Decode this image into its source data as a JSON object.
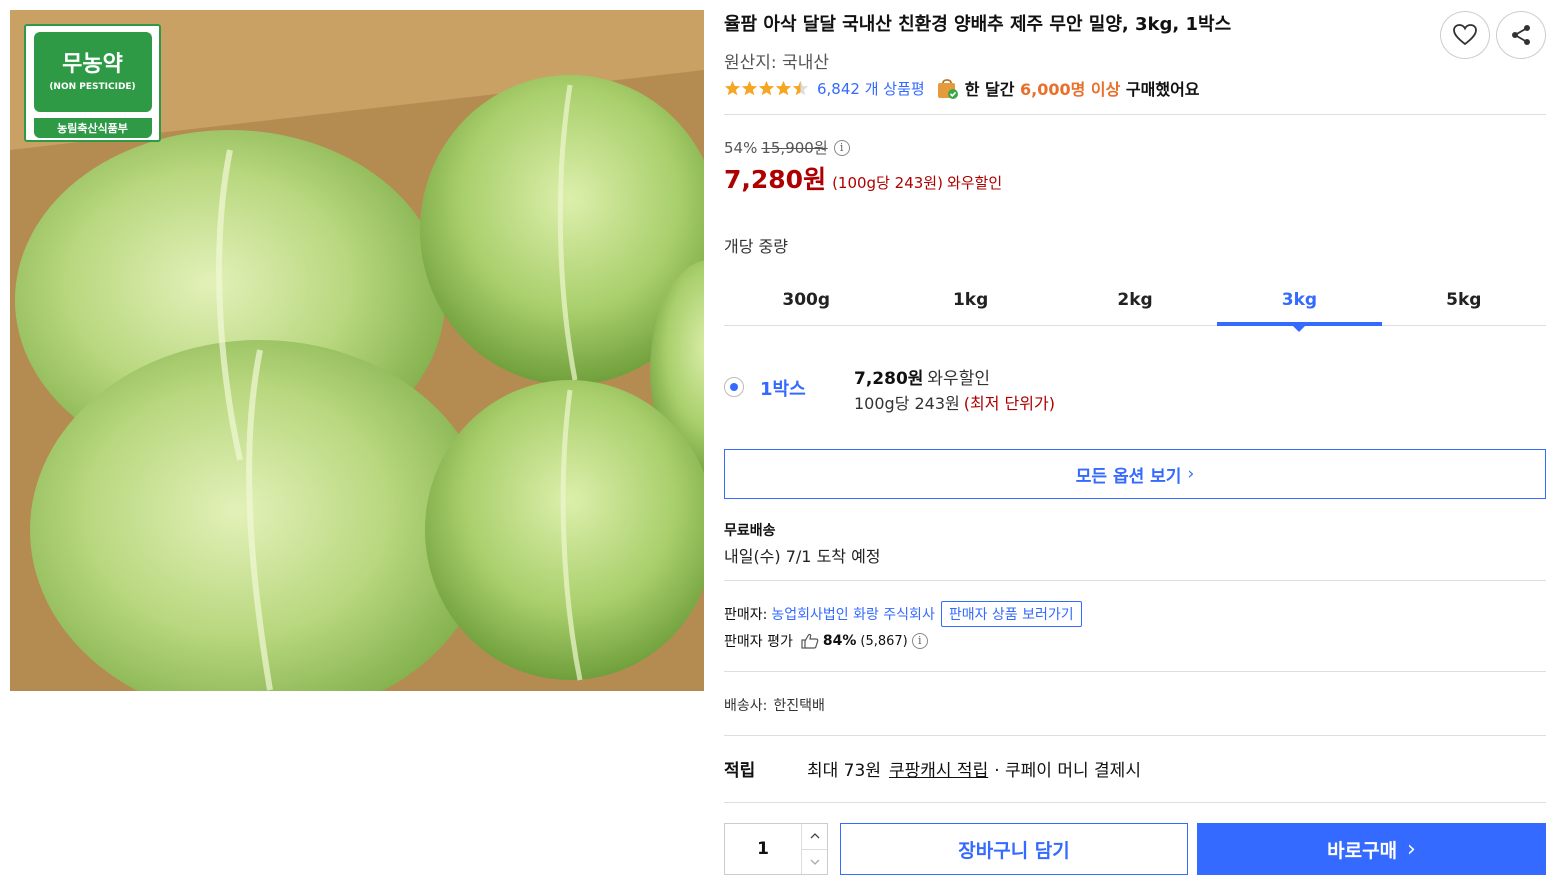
{
  "product": {
    "title": "율팜 아삭 달달 국내산 친환경 양배추 제주 무안 밀양, 3kg, 1박스",
    "origin": "원산지: 국내산",
    "rating": 4.5,
    "review_count": "6,842 개 상품평",
    "buyers_prefix": "한 달간",
    "buyers_highlight": "6,000명 이상",
    "buyers_suffix": "구매했어요"
  },
  "image": {
    "badge_main": "무농약",
    "badge_en": "(NON PESTICIDE)",
    "badge_org": "농림축산식품부"
  },
  "price": {
    "discount": "54%",
    "original": "15,900원",
    "info_icon": "i",
    "current": "7,280원",
    "unit_price": "(100g당 243원)",
    "wow": "와우할인"
  },
  "options": {
    "label": "개당 중량",
    "tabs": [
      "300g",
      "1kg",
      "2kg",
      "3kg",
      "5kg"
    ],
    "active_tab": 3,
    "selected": {
      "name": "1박스",
      "price": "7,280원",
      "wow": "와우할인",
      "unit": "100g당 243원",
      "lowest": "(최저 단위가)"
    },
    "all_options": "모든 옵션 보기",
    "chevron": "›"
  },
  "shipping": {
    "title": "무료배송",
    "date": "내일(수) 7/1 도착 예정"
  },
  "seller": {
    "label": "판매자:",
    "name": "농업회사법인 화랑 주식회사",
    "view_button": "판매자 상품 보러가기",
    "rating_label": "판매자 평가",
    "rating_pct": "84%",
    "rating_count": "(5,867)",
    "info_icon": "i"
  },
  "carrier": {
    "label": "배송사:",
    "name": "한진택배"
  },
  "reward": {
    "label": "적립",
    "prefix": "최대 73원",
    "link": "쿠팡캐시 적립",
    "suffix": "· 쿠페이 머니 결제시"
  },
  "purchase": {
    "quantity": "1",
    "cart": "장바구니 담기",
    "buy": "바로구매",
    "buy_chevron": "›"
  },
  "colors": {
    "accent": "#346aff",
    "price_red": "#ae0000",
    "highlight_orange": "#e8702a",
    "star": "#f5a623",
    "badge_green": "#2f9a46"
  },
  "icons": [
    "heart-icon",
    "share-icon",
    "star-icon",
    "shopping-bag-icon",
    "info-icon",
    "thumbs-up-icon",
    "chevron-up-icon",
    "chevron-down-icon",
    "chevron-right-icon"
  ]
}
